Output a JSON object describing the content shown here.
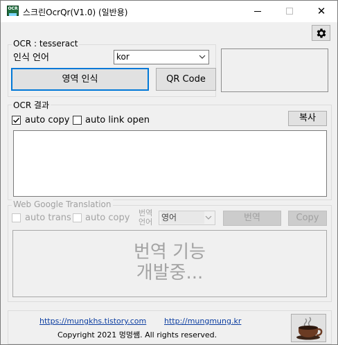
{
  "window": {
    "title": "스크린OcrQr(V1.0) (일반용)",
    "icon_text": "OCR",
    "controls": {
      "minimize": "minimize-icon",
      "maximize": "maximize-icon",
      "close": "✕"
    }
  },
  "settings_icon": "gear-icon",
  "ocr_group": {
    "title": "OCR : tesseract",
    "language_label": "인식 언어",
    "language_value": "kor",
    "region_button": "영역 인식",
    "qr_button": "QR Code"
  },
  "result_group": {
    "title": "OCR 결과",
    "auto_copy_label": "auto copy",
    "auto_copy_checked": true,
    "auto_link_label": "auto link open",
    "auto_link_checked": false,
    "copy_button": "복사",
    "result_text": ""
  },
  "translation_group": {
    "title": "Web Google Translation",
    "auto_trans_label": "auto trans",
    "auto_copy_label": "auto copy",
    "lang_label_1": "번역",
    "lang_label_2": "언어",
    "lang_value": "영어",
    "translate_button": "번역",
    "copy_button": "Copy",
    "placeholder_line1": "번역 기능",
    "placeholder_line2": "개발중..."
  },
  "footer": {
    "link1": "https://mungkhs.tistory.com",
    "link2": "http://mungmung.kr",
    "copyright": "Copyright 2021 멍멍쌤. All rights reserved.",
    "coffee_icon": "coffee-cup-icon"
  }
}
